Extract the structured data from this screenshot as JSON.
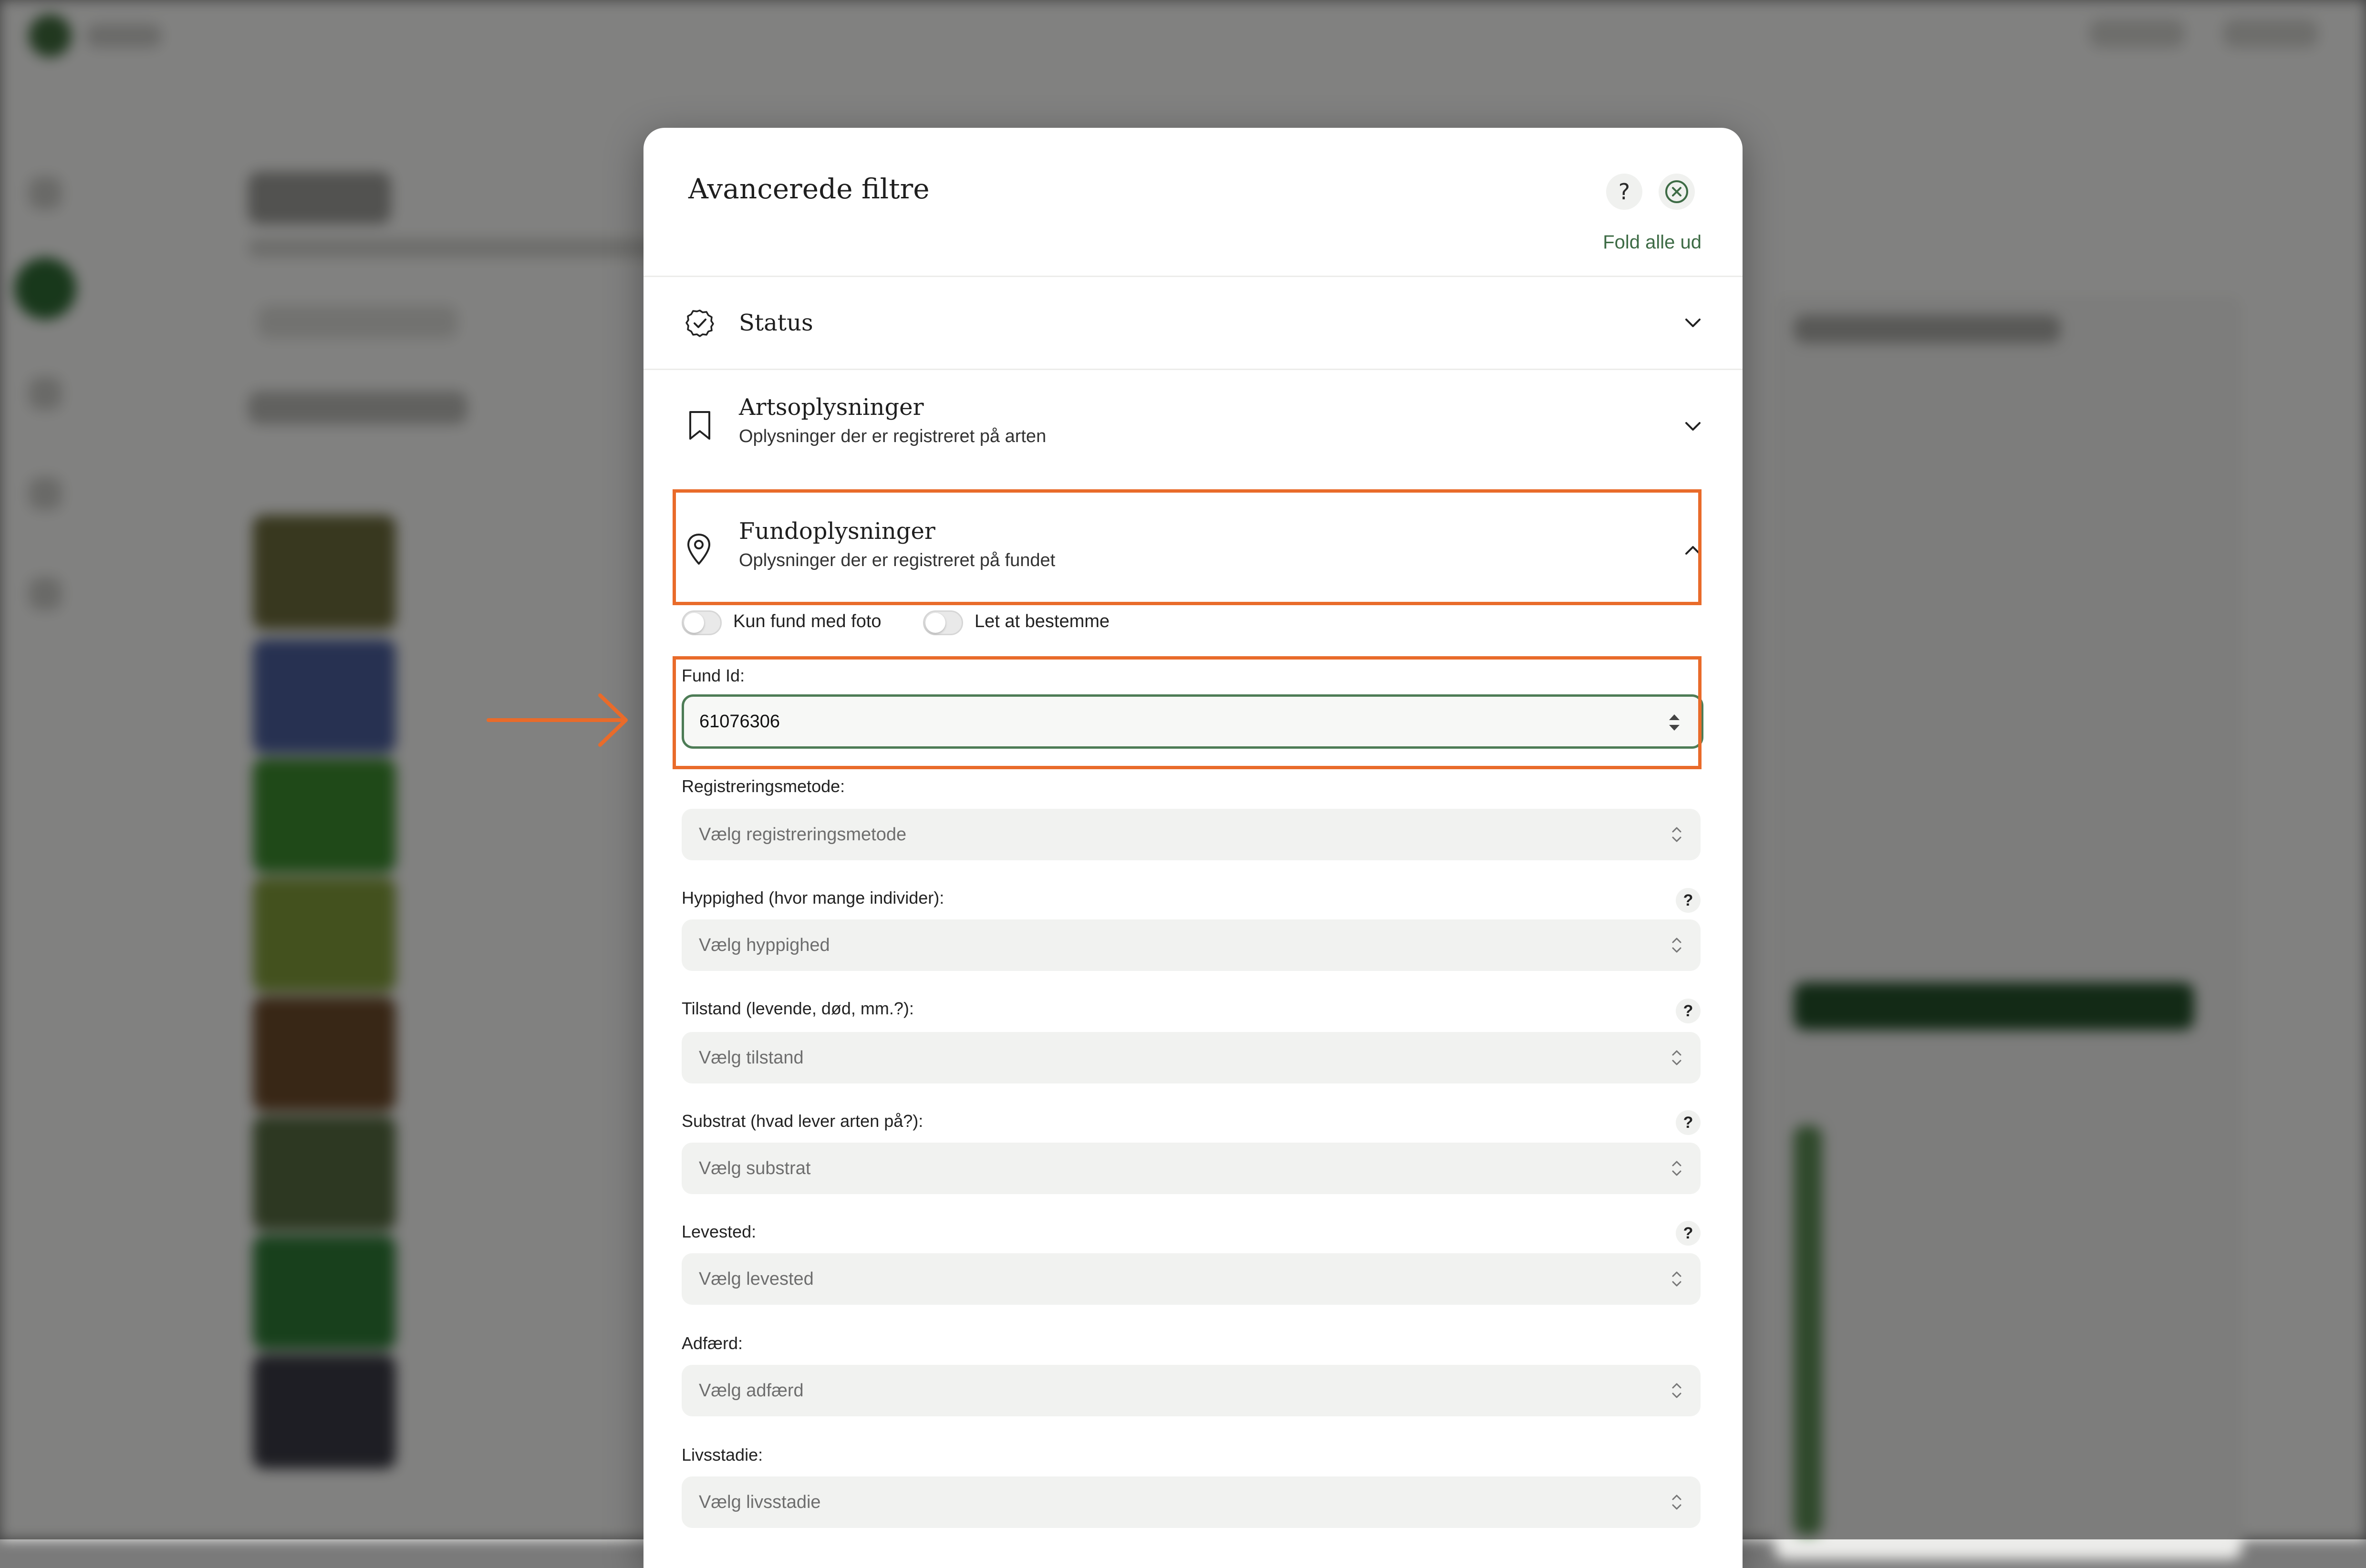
{
  "modal": {
    "title": "Avancerede filtre",
    "help_label": "?",
    "fold_all_label": "Fold alle ud"
  },
  "sections": [
    {
      "title": "Status",
      "subtitle": "",
      "expanded": false,
      "icon": "check-circle-icon"
    },
    {
      "title": "Artsoplysninger",
      "subtitle": "Oplysninger der er registreret på arten",
      "expanded": false,
      "icon": "bookmark-icon"
    },
    {
      "title": "Fundoplysninger",
      "subtitle": "Oplysninger der er registreret på fundet",
      "expanded": true,
      "icon": "map-pin-icon"
    }
  ],
  "toggles": [
    {
      "label": "Kun fund med foto",
      "on": false
    },
    {
      "label": "Let at bestemme",
      "on": false
    }
  ],
  "fund_id": {
    "label": "Fund Id:",
    "value": "61076306"
  },
  "fields": [
    {
      "label": "Registreringsmetode:",
      "placeholder": "Vælg registreringsmetode",
      "help": false
    },
    {
      "label": "Hyppighed (hvor mange individer):",
      "placeholder": "Vælg hyppighed",
      "help": true
    },
    {
      "label": "Tilstand (levende, død, mm.?):",
      "placeholder": "Vælg tilstand",
      "help": true
    },
    {
      "label": "Substrat (hvad lever arten på?):",
      "placeholder": "Vælg substrat",
      "help": true
    },
    {
      "label": "Levested:",
      "placeholder": "Vælg levested",
      "help": true
    },
    {
      "label": "Adfærd:",
      "placeholder": "Vælg adfærd",
      "help": false
    },
    {
      "label": "Livsstadie:",
      "placeholder": "Vælg livsstadie",
      "help": false
    }
  ],
  "colors": {
    "accent_green": "#3d6b45",
    "highlight_orange": "#e96b2a"
  }
}
